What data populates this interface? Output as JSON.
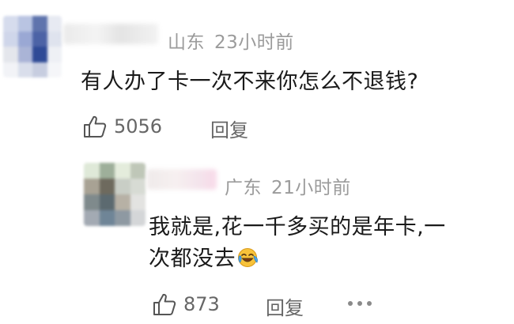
{
  "comments": [
    {
      "avatar_colors": [
        "#d6dced",
        "#b9c4e2",
        "#5f74ad",
        "#e7eaf2",
        "#cfd6ea",
        "#9aa8d4",
        "#4c63a6",
        "#dfe3ee",
        "#e4e6ec",
        "#aab4d6",
        "#2f4a96",
        "#eef0f5",
        "#f2f3f7",
        "#d9deeb",
        "#c7cde0",
        "#f5f6f9"
      ],
      "location": "山东",
      "time": "23小时前",
      "text": "有人办了卡一次不来你怎么不退钱?",
      "likes": "5056",
      "reply_label": "回复"
    },
    {
      "avatar_colors": [
        "#dfe9d8",
        "#9eaf9a",
        "#e4ecdc",
        "#bfc7b8",
        "#a8a294",
        "#6e6a5e",
        "#c9cec6",
        "#d7dbd4",
        "#7f8a8c",
        "#5c6a70",
        "#b7b1a5",
        "#e3e3e1",
        "#a3aab3",
        "#6f8597",
        "#8e99a2",
        "#d4d6d8"
      ],
      "location": "广东",
      "time": "21小时前",
      "text_line1": "我就是,花一千多买的是年卡,一",
      "text_line2": "次都没去",
      "emoji_name": "laugh-cry-emoji",
      "likes": "873",
      "reply_label": "回复"
    }
  ]
}
